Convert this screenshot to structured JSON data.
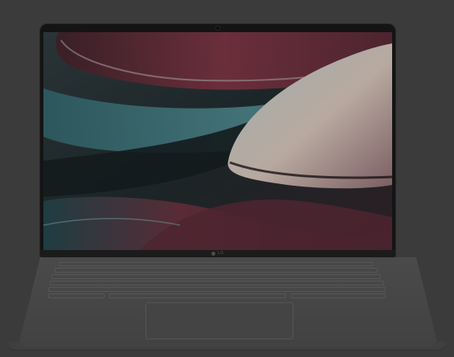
{
  "device": {
    "type": "laptop",
    "brand_logo": "LG",
    "screen": {
      "wallpaper": "abstract-curved-shapes",
      "colors": {
        "teal": "#3b6f74",
        "maroon": "#6e2f3b",
        "cream": "#b8a9a0",
        "shadow": "#0f1416"
      }
    },
    "keyboard": {
      "rows": 5
    }
  },
  "colors": {
    "background": "#3b3b3b",
    "bezel": "#141414",
    "body": "#474747"
  }
}
